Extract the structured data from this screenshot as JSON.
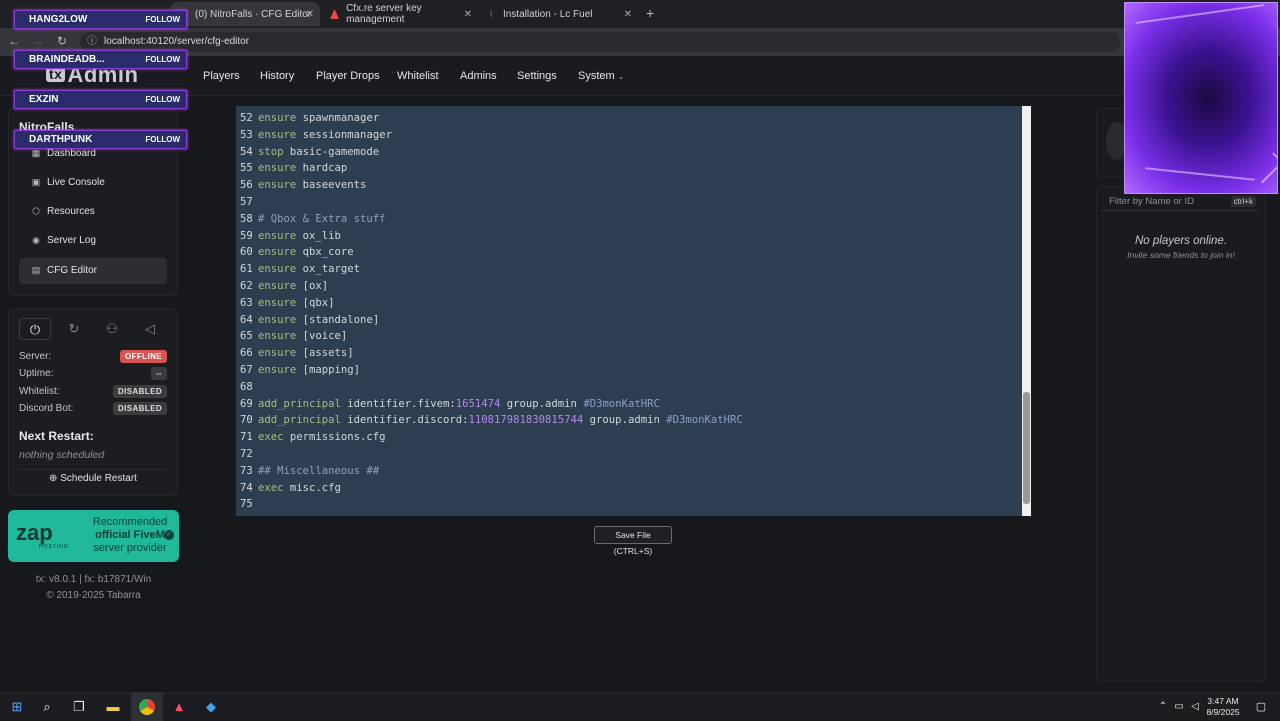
{
  "browser": {
    "tabs": [
      {
        "title": "(0) NitroFalls · CFG Editor",
        "active": true
      },
      {
        "title": "Cfx.re server key management",
        "active": false
      },
      {
        "title": "Installation - Lc Fuel",
        "active": false
      }
    ],
    "url": "localhost:40120/server/cfg-editor"
  },
  "overlay": {
    "follow_label": "FOLLOW",
    "followers": [
      "HANG2LOW",
      "BRAINDEADB...",
      "EXZIN",
      "DARTHPUNK"
    ]
  },
  "app": {
    "logo_tx": "tx",
    "logo_text": "Admin",
    "nav": [
      "Players",
      "History",
      "Player Drops",
      "Whitelist",
      "Admins",
      "Settings",
      "System"
    ],
    "server_name": "NitroFalls",
    "sidebar": [
      "Dashboard",
      "Live Console",
      "Resources",
      "Server Log",
      "CFG Editor"
    ],
    "status": {
      "server_label": "Server:",
      "server_value": "OFFLINE",
      "uptime_label": "Uptime:",
      "uptime_value": "--",
      "whitelist_label": "Whitelist:",
      "whitelist_value": "DISABLED",
      "discord_label": "Discord Bot:",
      "discord_value": "DISABLED"
    },
    "next_restart_title": "Next Restart:",
    "next_restart_value": "nothing scheduled",
    "schedule_restart": "Schedule Restart",
    "promo": {
      "brand": "zap",
      "sub": "HOSTING",
      "line1": "Recommended",
      "line2": "official FiveM",
      "line3": "server provider"
    },
    "version": "tx: v8.0.1 | fx: b17871/Win",
    "copyright": "© 2019-2025 Tabarra",
    "save_button": "Save File (CTRL+S)",
    "filter_placeholder": "Filter by Name or ID",
    "filter_shortcut": "ctrl+k",
    "no_players": "No players online.",
    "no_players_sub": "Invite some friends to join in!"
  },
  "editor": {
    "lines": [
      {
        "n": "52",
        "kw": "ensure",
        "rest": " spawnmanager"
      },
      {
        "n": "53",
        "kw": "ensure",
        "rest": " sessionmanager"
      },
      {
        "n": "54",
        "kw": "stop",
        "rest": " basic-gamemode"
      },
      {
        "n": "55",
        "kw": "ensure",
        "rest": " hardcap"
      },
      {
        "n": "56",
        "kw": "ensure",
        "rest": " baseevents"
      },
      {
        "n": "57",
        "kw": "",
        "rest": ""
      },
      {
        "n": "58",
        "cm": "# Qbox & Extra stuff"
      },
      {
        "n": "59",
        "kw": "ensure",
        "rest": " ox_lib"
      },
      {
        "n": "60",
        "kw": "ensure",
        "rest": " qbx_core"
      },
      {
        "n": "61",
        "kw": "ensure",
        "rest": " ox_target"
      },
      {
        "n": "62",
        "kw": "ensure",
        "rest": " [ox]"
      },
      {
        "n": "63",
        "kw": "ensure",
        "rest": " [qbx]"
      },
      {
        "n": "64",
        "kw": "ensure",
        "rest": " [standalone]"
      },
      {
        "n": "65",
        "kw": "ensure",
        "rest": " [voice]"
      },
      {
        "n": "66",
        "kw": "ensure",
        "rest": " [assets]"
      },
      {
        "n": "67",
        "kw": "ensure",
        "rest": " [mapping]"
      },
      {
        "n": "68",
        "kw": "",
        "rest": ""
      },
      {
        "n": "69",
        "kw": "add_principal",
        "rest": " identifier.fivem:",
        "num": "1651474",
        "rest2": " group.admin ",
        "tag": "#D3monKatHRC"
      },
      {
        "n": "70",
        "kw": "add_principal",
        "rest": " identifier.discord:",
        "num": "110817981830815744",
        "rest2": " group.admin ",
        "tag": "#D3monKatHRC"
      },
      {
        "n": "71",
        "kw": "exec",
        "rest": " permissions.cfg"
      },
      {
        "n": "72",
        "kw": "",
        "rest": ""
      },
      {
        "n": "73",
        "cm": "## Miscellaneous ##"
      },
      {
        "n": "74",
        "kw": "exec",
        "rest": " misc.cfg"
      },
      {
        "n": "75",
        "kw": "",
        "rest": ""
      }
    ]
  },
  "taskbar": {
    "time": "3:47 AM",
    "date": "8/9/2025"
  },
  "colors": {
    "accent": "#9ec27a",
    "offline": "#d9534f",
    "promo": "#1fb89a"
  }
}
